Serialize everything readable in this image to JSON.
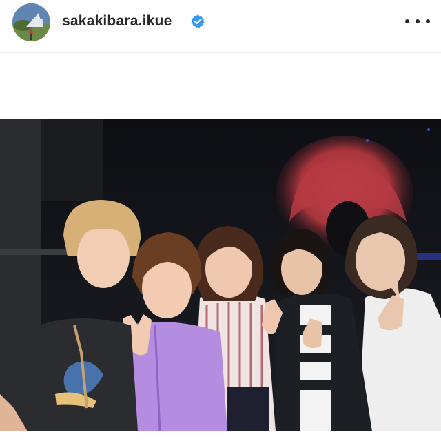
{
  "post": {
    "username": "sakakibara.ikue",
    "verified": true,
    "more_menu_icon": "more-horizontal-icon",
    "accent_color": "#3897f0",
    "text_color": "#262626"
  },
  "photo": {
    "subject": "five-women-group-photo"
  }
}
